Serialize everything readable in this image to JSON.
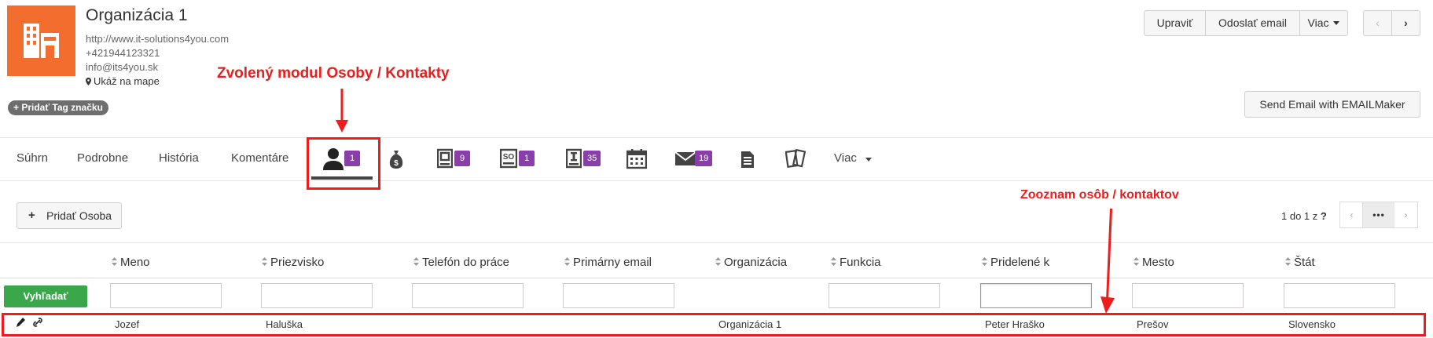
{
  "header": {
    "title": "Organizácia 1",
    "website": "http://www.it-solutions4you.com",
    "phone": "+421944123321",
    "email": "info@its4you.sk",
    "map_label": "Ukáž na mape",
    "add_tag_label": "+ Pridať Tag značku",
    "buttons": {
      "edit": "Upraviť",
      "send_email": "Odoslať email",
      "more": "Viac",
      "prev": "‹",
      "next": "›",
      "emailmaker": "Send Email with EMAILMaker"
    }
  },
  "tabs": {
    "summary": "Súhrn",
    "details": "Podrobne",
    "history": "História",
    "comments": "Komentáre",
    "contacts_count": "1",
    "quotes_count": "9",
    "sales_orders_count": "1",
    "invoices_count": "35",
    "emails_count": "19",
    "more": "Viac"
  },
  "toolbar": {
    "add_button": "Pridať Osoba",
    "add_plus": "+",
    "pager_text": "1 do 1  z",
    "pager_q": "?",
    "prev": "‹",
    "dots": "•••",
    "next": "›"
  },
  "table": {
    "columns": [
      "Meno",
      "Priezvisko",
      "Telefón do práce",
      "Primárny email",
      "Organizácia",
      "Funkcia",
      "Pridelené k",
      "Mesto",
      "Štát"
    ],
    "search_button": "Vyhľadať",
    "rows": [
      {
        "first_name": "Jozef",
        "last_name": "Haluška",
        "work_phone": "",
        "primary_email": "",
        "organization": "Organizácia 1",
        "function": "",
        "assigned_to": "Peter Hraško",
        "city": "Prešov",
        "country": "Slovensko"
      }
    ]
  },
  "annotations": {
    "selected_module": "Zvolený modul Osoby / Kontakty",
    "contacts_list": "Zooznam osôb / kontaktov"
  },
  "colors": {
    "brand_orange": "#f36d2f",
    "badge_purple": "#8a3ea9",
    "search_green": "#3aa84a",
    "annotation_red": "#ee1c1c"
  }
}
